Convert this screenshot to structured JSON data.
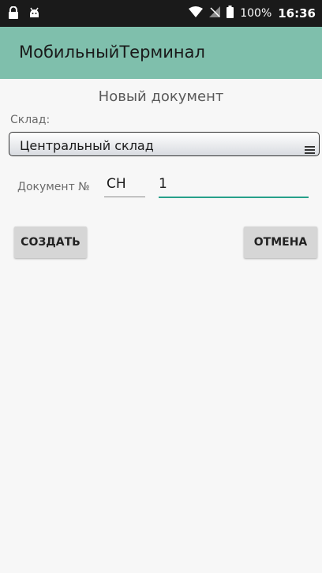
{
  "status_bar": {
    "battery": "100%",
    "time": "16:36",
    "icons": [
      "lock-icon",
      "android-icon",
      "wifi-icon",
      "no-sim-icon",
      "battery-icon"
    ]
  },
  "app_bar": {
    "title": "МобильныйТерминал",
    "color": "#7fbfac"
  },
  "form": {
    "title": "Новый документ",
    "warehouse_label": "Склад:",
    "warehouse_value": "Центральный склад",
    "doc_label": "Документ №",
    "doc_prefix": "СН",
    "doc_number": "1",
    "accent_color": "#26a08a"
  },
  "buttons": {
    "create": "СОЗДАТЬ",
    "cancel": "ОТМЕНА"
  }
}
